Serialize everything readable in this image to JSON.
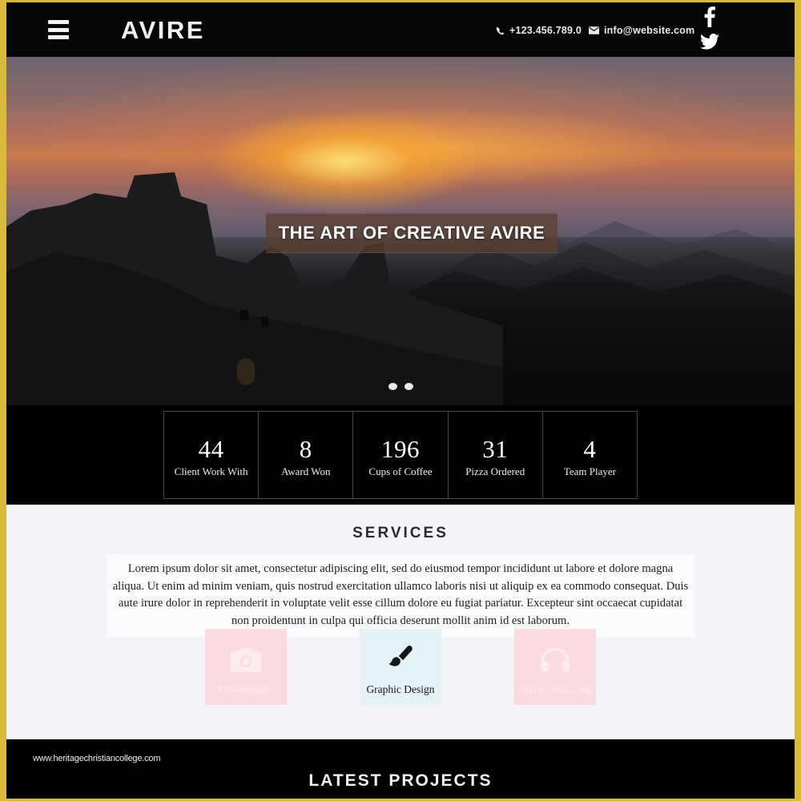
{
  "theme": {
    "frame_color": "#d9bb3c",
    "header_bg": "#060606",
    "services_bg": "#f4f4f9",
    "card_pink": "#fadce0",
    "card_blue": "#e4f2f6",
    "caption_bg": "#5c3e30"
  },
  "header": {
    "menu_icon": "hamburger-icon",
    "brand": "AVIRE",
    "phone": {
      "icon": "phone-icon",
      "text": "+123.456.789.0"
    },
    "email": {
      "icon": "envelope-icon",
      "text": "info@website.com"
    },
    "social": [
      {
        "name": "facebook",
        "icon": "facebook-icon",
        "glyph": "f"
      },
      {
        "name": "twitter",
        "icon": "twitter-icon",
        "glyph": "twitter-bird"
      }
    ]
  },
  "hero": {
    "caption": "THE ART OF CREATIVE AVIRE",
    "slides": [
      {
        "active": true
      },
      {
        "active": false
      }
    ],
    "dots_count": 2
  },
  "stats": [
    {
      "number": "44",
      "label": "Client Work With"
    },
    {
      "number": "8",
      "label": "Award Won"
    },
    {
      "number": "196",
      "label": "Cups of Coffee"
    },
    {
      "number": "31",
      "label": "Pizza Ordered"
    },
    {
      "number": "4",
      "label": "Team Player"
    }
  ],
  "services": {
    "title": "SERVICES",
    "description": "Lorem ipsum dolor sit amet, consectetur adipiscing elit, sed do eiusmod tempor incididunt ut labore et dolore magna aliqua. Ut enim ad minim veniam, quis nostrud exercitation ullamco laboris nisi ut aliquip ex ea commodo consequat. Duis aute irure dolor in reprehenderit in voluptate velit esse cillum dolore eu fugiat pariatur. Excepteur sint occaecat cupidatat non proidentunt in culpa qui officia deserunt mollit anim id est laborum.",
    "cards": [
      {
        "label": "Photography",
        "icon": "camera-icon",
        "bg": "#fadce0"
      },
      {
        "label": "Graphic Design",
        "icon": "paintbrush-icon",
        "bg": "#e4f2f6"
      },
      {
        "label": "Audio Producing",
        "icon": "headphones-icon",
        "bg": "#fadce0"
      }
    ]
  },
  "footer": {
    "watermark": "www.heritagechristiancollege.com",
    "projects_title": "LATEST PROJECTS"
  }
}
